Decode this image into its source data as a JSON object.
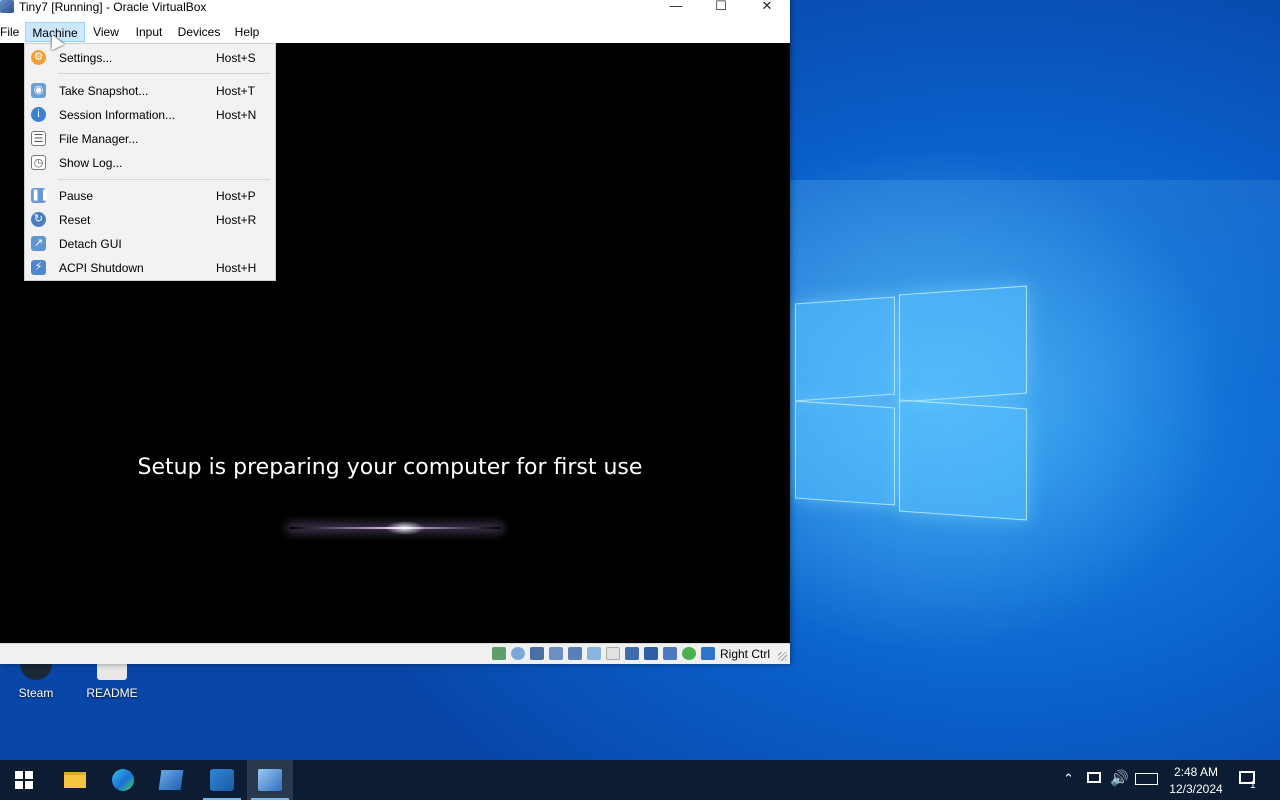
{
  "window": {
    "title": "Tiny7 [Running] - Oracle VirtualBox",
    "minimize_icon": "minimize-icon",
    "maximize_icon": "maximize-icon",
    "close_icon": "close-icon"
  },
  "menubar": {
    "items": [
      "File",
      "Machine",
      "View",
      "Input",
      "Devices",
      "Help"
    ],
    "active": "Machine"
  },
  "machine_menu": {
    "items": [
      {
        "label": "Settings...",
        "shortcut": "Host+S",
        "icon": "settings-icon"
      },
      {
        "label": "Take Snapshot...",
        "shortcut": "Host+T",
        "icon": "snapshot-icon"
      },
      {
        "label": "Session Information...",
        "shortcut": "Host+N",
        "icon": "info-icon"
      },
      {
        "label": "File Manager...",
        "shortcut": "",
        "icon": "file-manager-icon"
      },
      {
        "label": "Show Log...",
        "shortcut": "",
        "icon": "log-icon"
      },
      {
        "label": "Pause",
        "shortcut": "Host+P",
        "icon": "pause-icon"
      },
      {
        "label": "Reset",
        "shortcut": "Host+R",
        "icon": "reset-icon"
      },
      {
        "label": "Detach GUI",
        "shortcut": "",
        "icon": "detach-icon"
      },
      {
        "label": "ACPI Shutdown",
        "shortcut": "Host+H",
        "icon": "shutdown-icon"
      }
    ]
  },
  "vm_screen": {
    "message": "Setup is preparing your computer for first use"
  },
  "statusbar": {
    "host_key": "Right Ctrl",
    "indicators": [
      "hard-disk-icon",
      "optical-drive-icon",
      "floppy-icon",
      "audio-icon",
      "network-icon",
      "usb-icon",
      "shared-folders-icon",
      "display-icon",
      "video-capture-icon",
      "cpu-icon",
      "mouse-integration-icon",
      "keyboard-icon"
    ]
  },
  "desktop": {
    "icons": [
      {
        "label": "Steam"
      },
      {
        "label": "README"
      }
    ]
  },
  "taskbar": {
    "apps": [
      "start-icon",
      "file-explorer-icon",
      "edge-icon",
      "virtualbox-manager-icon",
      "vscode-icon",
      "virtualbox-vm-icon"
    ],
    "clock_time": "2:48 AM",
    "clock_date": "12/3/2024",
    "notification_count": "1"
  },
  "colors": {
    "menu_active": "#cce8ff",
    "taskbar": "#0c1d33",
    "desktop_blue": "#0a5ec9"
  }
}
